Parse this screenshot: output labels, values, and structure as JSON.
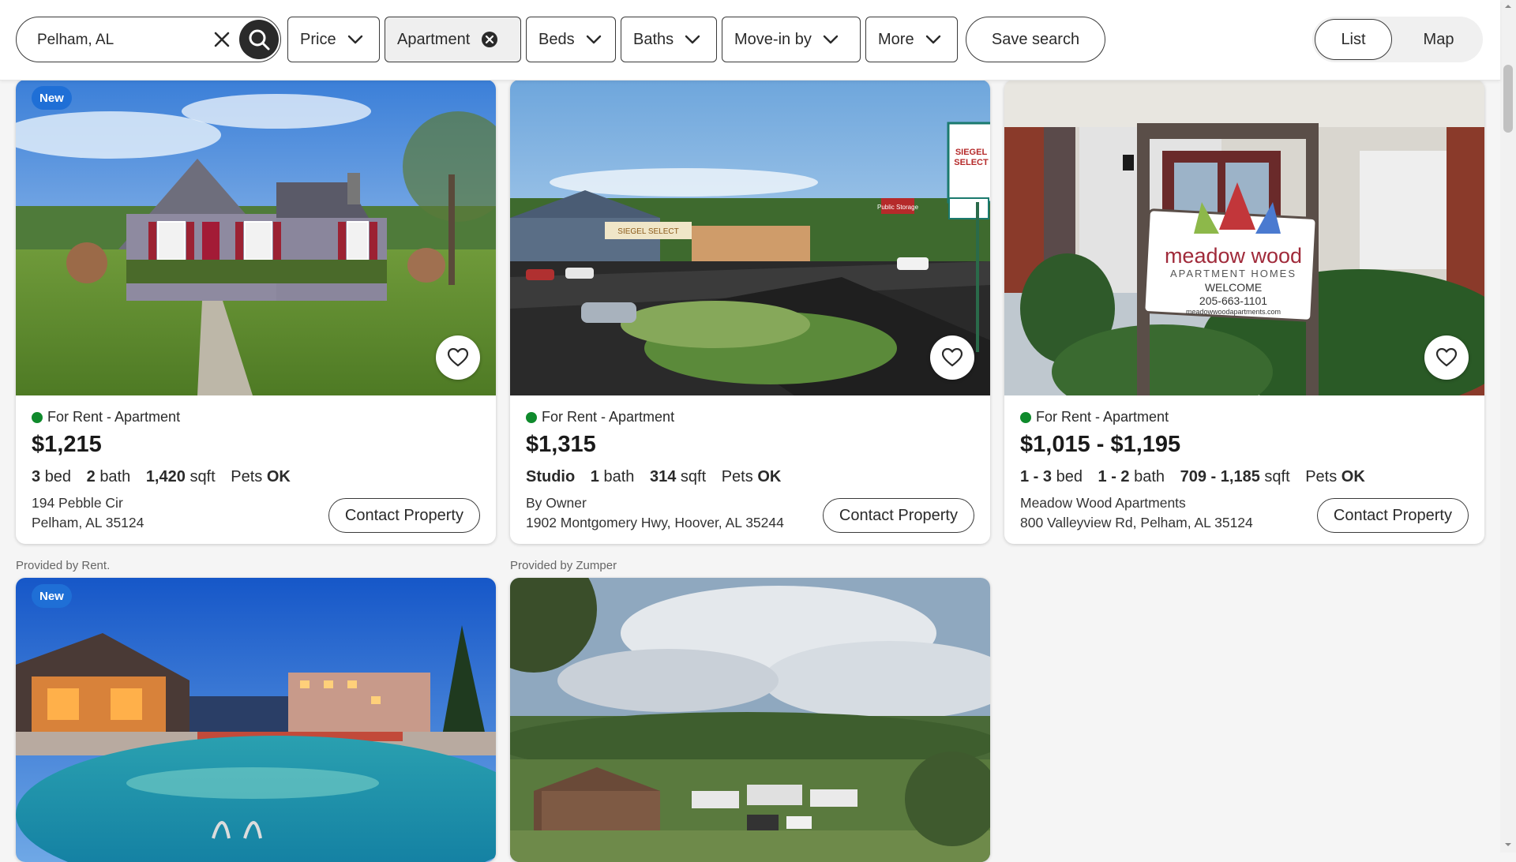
{
  "search": {
    "value": "Pelham, AL"
  },
  "filters": {
    "price": "Price",
    "apartment": "Apartment",
    "beds": "Beds",
    "baths": "Baths",
    "move_in": "Move-in by",
    "more": "More"
  },
  "save_search": "Save search",
  "view": {
    "list": "List",
    "map": "Map",
    "selected": "List"
  },
  "listings": [
    {
      "badge": "New",
      "status": "For Rent - Apartment",
      "price": "$1,215",
      "beds_val": "3",
      "beds_unit": "bed",
      "bath_val": "2",
      "bath_unit": "bath",
      "sqft_val": "1,420",
      "sqft_unit": "sqft",
      "pets_label": "Pets",
      "pets_val": "OK",
      "line1": "194 Pebble Cir",
      "line2": "Pelham, AL 35124",
      "contact": "Contact Property"
    },
    {
      "status": "For Rent - Apartment",
      "price": "$1,315",
      "beds_val": "Studio",
      "bath_val": "1",
      "bath_unit": "bath",
      "sqft_val": "314",
      "sqft_unit": "sqft",
      "pets_label": "Pets",
      "pets_val": "OK",
      "line1": "By Owner",
      "line2": "1902 Montgomery Hwy, Hoover, AL 35244",
      "contact": "Contact Property",
      "photo_sign": "SIEGEL SELECT",
      "photo_sign_small": "Public Storage"
    },
    {
      "status": "For Rent - Apartment",
      "price": "$1,015 - $1,195",
      "beds_val": "1 - 3",
      "beds_unit": "bed",
      "bath_val": "1 - 2",
      "bath_unit": "bath",
      "sqft_val": "709 - 1,185",
      "sqft_unit": "sqft",
      "pets_label": "Pets",
      "pets_val": "OK",
      "line1": "Meadow Wood Apartments",
      "line2": "800 Valleyview Rd, Pelham, AL 35124",
      "contact": "Contact Property",
      "photo_sign": {
        "name": "meadow wood",
        "sub": "APARTMENT HOMES",
        "welcome": "WELCOME",
        "phone": "205-663-1101",
        "site": "meadowwoodapartments.com"
      }
    },
    {
      "provided": "Provided by Rent.",
      "badge": "New"
    },
    {
      "provided": "Provided by Zumper"
    }
  ],
  "icons": {
    "clear": "close-icon",
    "search": "search-icon",
    "chevron": "chevron-down-icon",
    "remove": "remove-filter-icon",
    "favorite": "heart-icon"
  },
  "colors": {
    "available_dot": "#0f8a2c",
    "new_badge": "#1f6fd6",
    "text": "#2a2a2a"
  }
}
